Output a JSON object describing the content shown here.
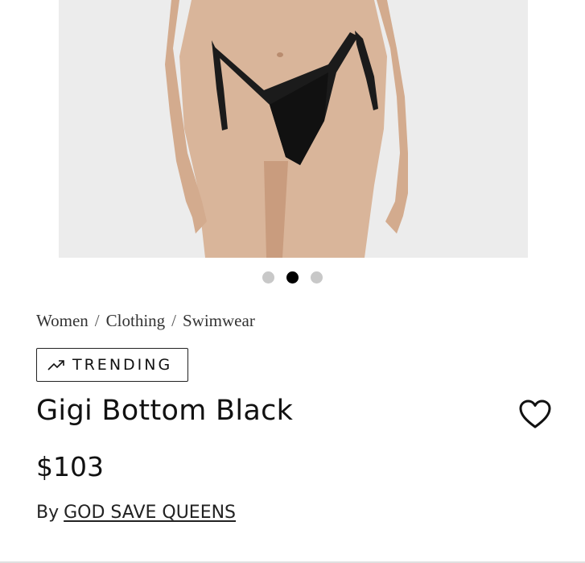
{
  "carousel": {
    "slide_count": 3,
    "active_index": 1
  },
  "breadcrumb": {
    "items": [
      "Women",
      "Clothing",
      "Swimwear"
    ],
    "separator": "/"
  },
  "badge": {
    "label": "TRENDING",
    "icon": "trending-up-icon"
  },
  "product": {
    "title": "Gigi Bottom Black",
    "price": "$103",
    "by_label": "By",
    "brand": "GOD SAVE QUEENS"
  },
  "actions": {
    "wishlist_icon": "heart-icon"
  },
  "colors": {
    "hero_background": "#ececec",
    "dot_active": "#000000",
    "dot_inactive": "#c8c8c8"
  }
}
